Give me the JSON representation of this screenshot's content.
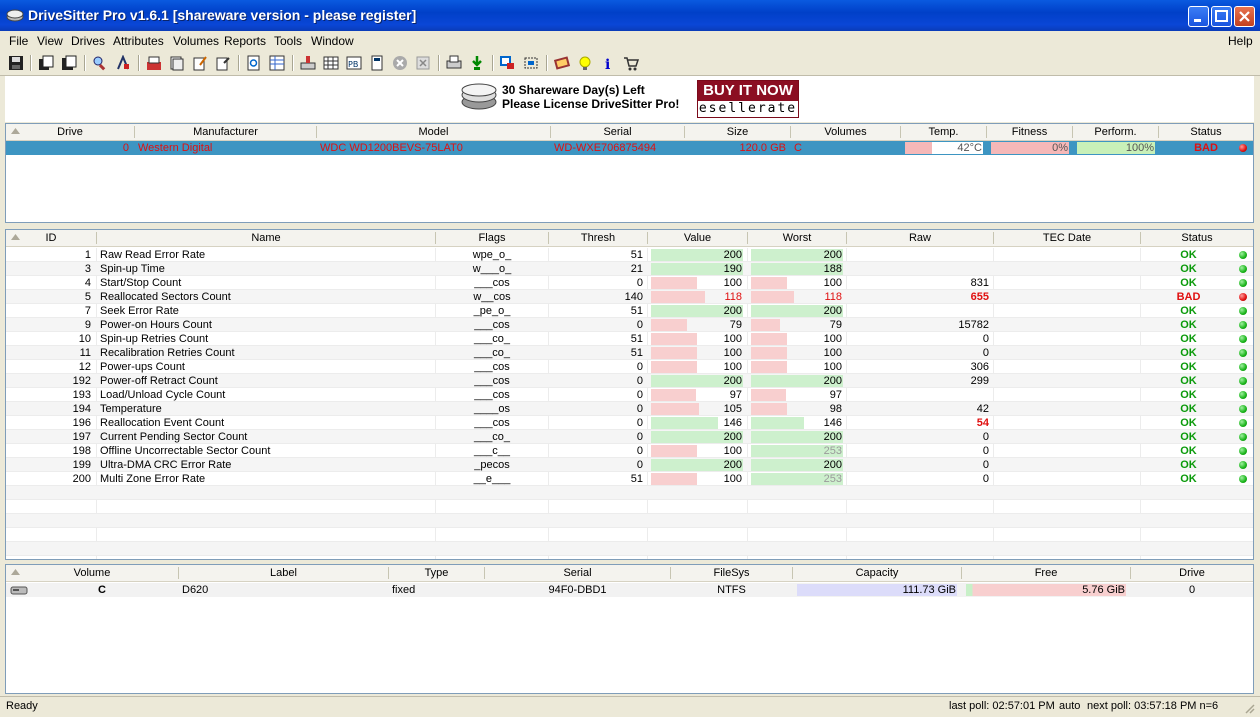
{
  "window": {
    "title": "DriveSitter Pro v1.6.1 [shareware version - please register]"
  },
  "menu": [
    "File",
    "View",
    "Drives",
    "Attributes",
    "Volumes",
    "Reports",
    "Tools",
    "Window"
  ],
  "menu_help": "Help",
  "toolbar_icons": [
    "save-icon",
    "open-icon",
    "saveas-icon",
    "search-icon",
    "tools-icon",
    "export-icon",
    "stack-icon",
    "edit-icon",
    "note-icon",
    "refresh-icon",
    "grid-icon",
    "drive-icon",
    "table-icon",
    "pdf-icon",
    "calc-icon",
    "stop-icon",
    "close-icon",
    "print-icon",
    "download-icon",
    "window-icon",
    "fit-icon",
    "book-icon",
    "tip-icon",
    "info-icon",
    "cart-icon"
  ],
  "banner": {
    "line1": "30 Shareware Day(s) Left",
    "line2": "Please License DriveSitter Pro!",
    "buy": "BUY IT NOW",
    "brand": "esellerate"
  },
  "drives": {
    "headers": [
      "Drive",
      "Manufacturer",
      "Model",
      "Serial",
      "Size",
      "Volumes",
      "Temp.",
      "Fitness",
      "Perform.",
      "Status"
    ],
    "rows": [
      {
        "drive": "0",
        "manufacturer": "Western Digital",
        "model": "WDC WD1200BEVS-75LAT0",
        "serial": "WD-WXE706875494",
        "size": "120.0 GB",
        "volumes": "C",
        "temp": "42°C",
        "temp_level": 0.35,
        "fitness": "0%",
        "fitness_level": 1.0,
        "perform": "100%",
        "perform_level": 1.0,
        "status": "BAD"
      }
    ]
  },
  "attributes": {
    "headers": [
      "ID",
      "Name",
      "Flags",
      "Thresh",
      "Value",
      "Worst",
      "Raw",
      "TEC Date",
      "Status"
    ],
    "rows": [
      {
        "id": "1",
        "name": "Raw Read Error Rate",
        "flags": "wpe_o_",
        "thresh": "51",
        "value": "200",
        "worst": "200",
        "raw": "",
        "tec": "",
        "status": "OK"
      },
      {
        "id": "3",
        "name": "Spin-up Time",
        "flags": "w___o_",
        "thresh": "21",
        "value": "190",
        "worst": "188",
        "raw": "",
        "tec": "",
        "status": "OK"
      },
      {
        "id": "4",
        "name": "Start/Stop Count",
        "flags": "___cos",
        "thresh": "0",
        "value": "100",
        "worst": "100",
        "raw": "831",
        "tec": "",
        "status": "OK"
      },
      {
        "id": "5",
        "name": "Reallocated Sectors Count",
        "flags": "w__cos",
        "thresh": "140",
        "value": "118",
        "worst": "118",
        "raw": "655",
        "tec": "",
        "status": "BAD"
      },
      {
        "id": "7",
        "name": "Seek Error Rate",
        "flags": "_pe_o_",
        "thresh": "51",
        "value": "200",
        "worst": "200",
        "raw": "",
        "tec": "",
        "status": "OK"
      },
      {
        "id": "9",
        "name": "Power-on Hours Count",
        "flags": "___cos",
        "thresh": "0",
        "value": "79",
        "worst": "79",
        "raw": "15782",
        "tec": "",
        "status": "OK"
      },
      {
        "id": "10",
        "name": "Spin-up Retries Count",
        "flags": "___co_",
        "thresh": "51",
        "value": "100",
        "worst": "100",
        "raw": "0",
        "tec": "",
        "status": "OK"
      },
      {
        "id": "11",
        "name": "Recalibration Retries Count",
        "flags": "___co_",
        "thresh": "51",
        "value": "100",
        "worst": "100",
        "raw": "0",
        "tec": "",
        "status": "OK"
      },
      {
        "id": "12",
        "name": "Power-ups Count",
        "flags": "___cos",
        "thresh": "0",
        "value": "100",
        "worst": "100",
        "raw": "306",
        "tec": "",
        "status": "OK"
      },
      {
        "id": "192",
        "name": "Power-off Retract Count",
        "flags": "___cos",
        "thresh": "0",
        "value": "200",
        "worst": "200",
        "raw": "299",
        "tec": "",
        "status": "OK"
      },
      {
        "id": "193",
        "name": "Load/Unload Cycle Count",
        "flags": "___cos",
        "thresh": "0",
        "value": "97",
        "worst": "97",
        "raw": "",
        "tec": "",
        "status": "OK"
      },
      {
        "id": "194",
        "name": "Temperature",
        "flags": "____os",
        "thresh": "0",
        "value": "105",
        "worst": "98",
        "raw": "42",
        "tec": "",
        "status": "OK"
      },
      {
        "id": "196",
        "name": "Reallocation Event Count",
        "flags": "___cos",
        "thresh": "0",
        "value": "146",
        "worst": "146",
        "raw": "54",
        "tec": "",
        "status": "OK"
      },
      {
        "id": "197",
        "name": "Current Pending Sector Count",
        "flags": "___co_",
        "thresh": "0",
        "value": "200",
        "worst": "200",
        "raw": "0",
        "tec": "",
        "status": "OK"
      },
      {
        "id": "198",
        "name": "Offline Uncorrectable Sector Count",
        "flags": "___c__",
        "thresh": "0",
        "value": "100",
        "worst": "253",
        "raw": "0",
        "tec": "",
        "status": "OK"
      },
      {
        "id": "199",
        "name": "Ultra-DMA CRC Error Rate",
        "flags": "_pecos",
        "thresh": "0",
        "value": "200",
        "worst": "200",
        "raw": "0",
        "tec": "",
        "status": "OK"
      },
      {
        "id": "200",
        "name": "Multi Zone Error Rate",
        "flags": "__e___",
        "thresh": "51",
        "value": "100",
        "worst": "253",
        "raw": "0",
        "tec": "",
        "status": "OK"
      }
    ]
  },
  "volumes": {
    "headers": [
      "Volume",
      "Label",
      "Type",
      "Serial",
      "FileSys",
      "Capacity",
      "Free",
      "Drive"
    ],
    "rows": [
      {
        "volume": "C",
        "label": "D620",
        "type": "fixed",
        "serial": "94F0-DBD1",
        "filesys": "NTFS",
        "capacity": "111.73 GiB",
        "free": "5.76 GiB",
        "free_fraction": 0.052,
        "drive": "0"
      }
    ]
  },
  "status": {
    "left": "Ready",
    "last_poll": "last poll: 02:57:01 PM",
    "mode": "auto",
    "next_poll": "next poll: 03:57:18 PM n=6"
  },
  "colors": {
    "title_blue": "#0a4ce0",
    "ok_green": "#0a9a0a",
    "bad_red": "#e01010",
    "bar_green": "#c8f0c8",
    "bar_red": "#f5c0c0",
    "selected_row": "#3d95c2"
  }
}
